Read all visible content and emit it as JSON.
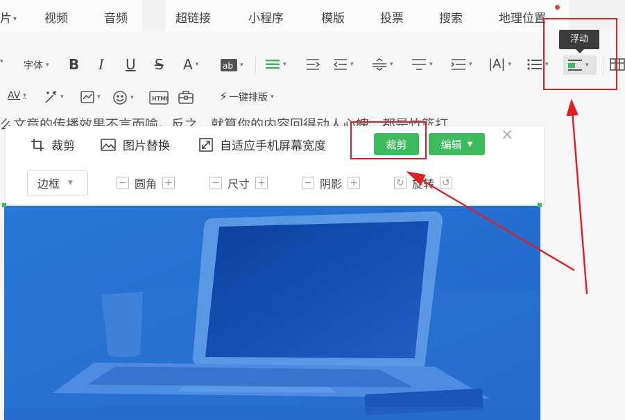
{
  "nav": {
    "items": [
      "片",
      "视频",
      "音频",
      "超链接",
      "小程序",
      "模版",
      "投票",
      "搜索",
      "地理位置"
    ]
  },
  "toolbar": {
    "font_label": "字体",
    "one_click_layout": "一键排版",
    "tooltip": "浮动"
  },
  "background_text": "么文章的传播效果不言而喻。反之，就算你的内容回得动人心魄，都是竹篮打",
  "image_panel": {
    "crop_tool": "裁剪",
    "replace_image": "图片替换",
    "fit_width": "自适应手机屏幕宽度",
    "crop_button": "裁剪",
    "edit_button": "编辑",
    "border_select": "边框",
    "rounded": "圆角",
    "size": "尺寸",
    "shadow": "阴影",
    "rotate": "旋转"
  },
  "colors": {
    "accent_green": "#3dbb5c",
    "annotation_red": "#e01f25",
    "image_blue": "#2e7bd6"
  }
}
